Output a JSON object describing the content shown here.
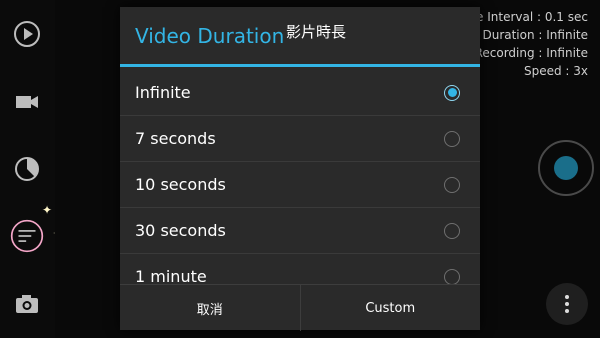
{
  "stats": {
    "line1": "e Interval : 0.1 sec",
    "line2": "Duration : Infinite",
    "line3": "Recording : Infinite",
    "line4": "Speed : 3x"
  },
  "dialog": {
    "title": "Video Duration",
    "caption": "影片時長",
    "options": [
      {
        "label": "Infinite",
        "selected": true
      },
      {
        "label": "7 seconds",
        "selected": false
      },
      {
        "label": "10 seconds",
        "selected": false
      },
      {
        "label": "30 seconds",
        "selected": false
      },
      {
        "label": "1 minute",
        "selected": false
      }
    ],
    "cancel_label": "取消",
    "custom_label": "Custom"
  },
  "colors": {
    "accent": "#33b5e5",
    "shutter": "#1a6e8a",
    "highlight_ring": "#f4a6c8",
    "sparkle": "#fff6c9"
  },
  "icons": {
    "rail": [
      "play-icon",
      "video-camera-icon",
      "timer-pie-icon",
      "sort-lines-icon",
      "camera-icon"
    ],
    "decoration": "sparkle-icon"
  }
}
